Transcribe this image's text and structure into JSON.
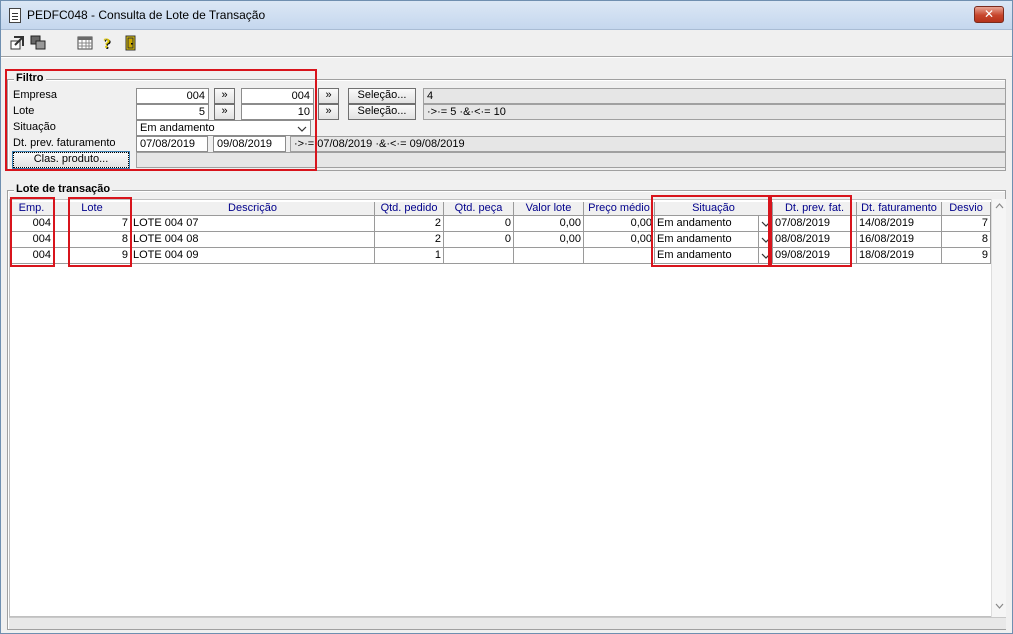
{
  "window": {
    "title": "PEDFC048 - Consulta de Lote de Transação",
    "close": "✕"
  },
  "toolbar": {
    "icons": [
      "export-icon",
      "multi-window-icon",
      "calculator-icon",
      "help-icon",
      "exit-door-icon"
    ]
  },
  "filter": {
    "title": "Filtro",
    "empresa_label": "Empresa",
    "empresa_from": "004",
    "empresa_to": "004",
    "lote_label": "Lote",
    "lote_from": "5",
    "lote_to": "10",
    "situacao_label": "Situação",
    "situacao_value": "Em andamento",
    "dt_label": "Dt. prev. faturamento",
    "dt_from": "07/08/2019",
    "dt_to": "09/08/2019",
    "arrow_btn": "»",
    "selecao_btn": "Seleção...",
    "empresa_summary": "4",
    "lote_summary": "·>·= 5 ·&·<·= 10",
    "dt_summary": "·>·= 07/08/2019 ·&·<·= 09/08/2019",
    "clas_btn": "Clas. produto..."
  },
  "grid": {
    "title": "Lote de transação",
    "columns": [
      "Emp.",
      "Lote",
      "Descrição",
      "Qtd. pedido",
      "Qtd. peça",
      "Valor lote",
      "Preço médio",
      "Situação",
      "Dt. prev. fat.",
      "Dt. faturamento",
      "Desvio"
    ],
    "rows": [
      {
        "emp": "004",
        "lote": "7",
        "descricao": "LOTE 004 07",
        "qtd_pedido": "2",
        "qtd_peca": "0",
        "valor_lote": "0,00",
        "preco_medio": "0,00",
        "situacao": "Em andamento",
        "dt_prev": "07/08/2019",
        "dt_fat": "14/08/2019",
        "desvio": "7"
      },
      {
        "emp": "004",
        "lote": "8",
        "descricao": "LOTE 004 08",
        "qtd_pedido": "2",
        "qtd_peca": "0",
        "valor_lote": "0,00",
        "preco_medio": "0,00",
        "situacao": "Em andamento",
        "dt_prev": "08/08/2019",
        "dt_fat": "16/08/2019",
        "desvio": "8"
      },
      {
        "emp": "004",
        "lote": "9",
        "descricao": "LOTE 004 09",
        "qtd_pedido": "1",
        "qtd_peca": "",
        "valor_lote": "",
        "preco_medio": "",
        "situacao": "Em andamento",
        "dt_prev": "09/08/2019",
        "dt_fat": "18/08/2019",
        "desvio": "9"
      }
    ]
  },
  "colors": {
    "highlight": "#d8141c",
    "header_text": "#00008b"
  }
}
